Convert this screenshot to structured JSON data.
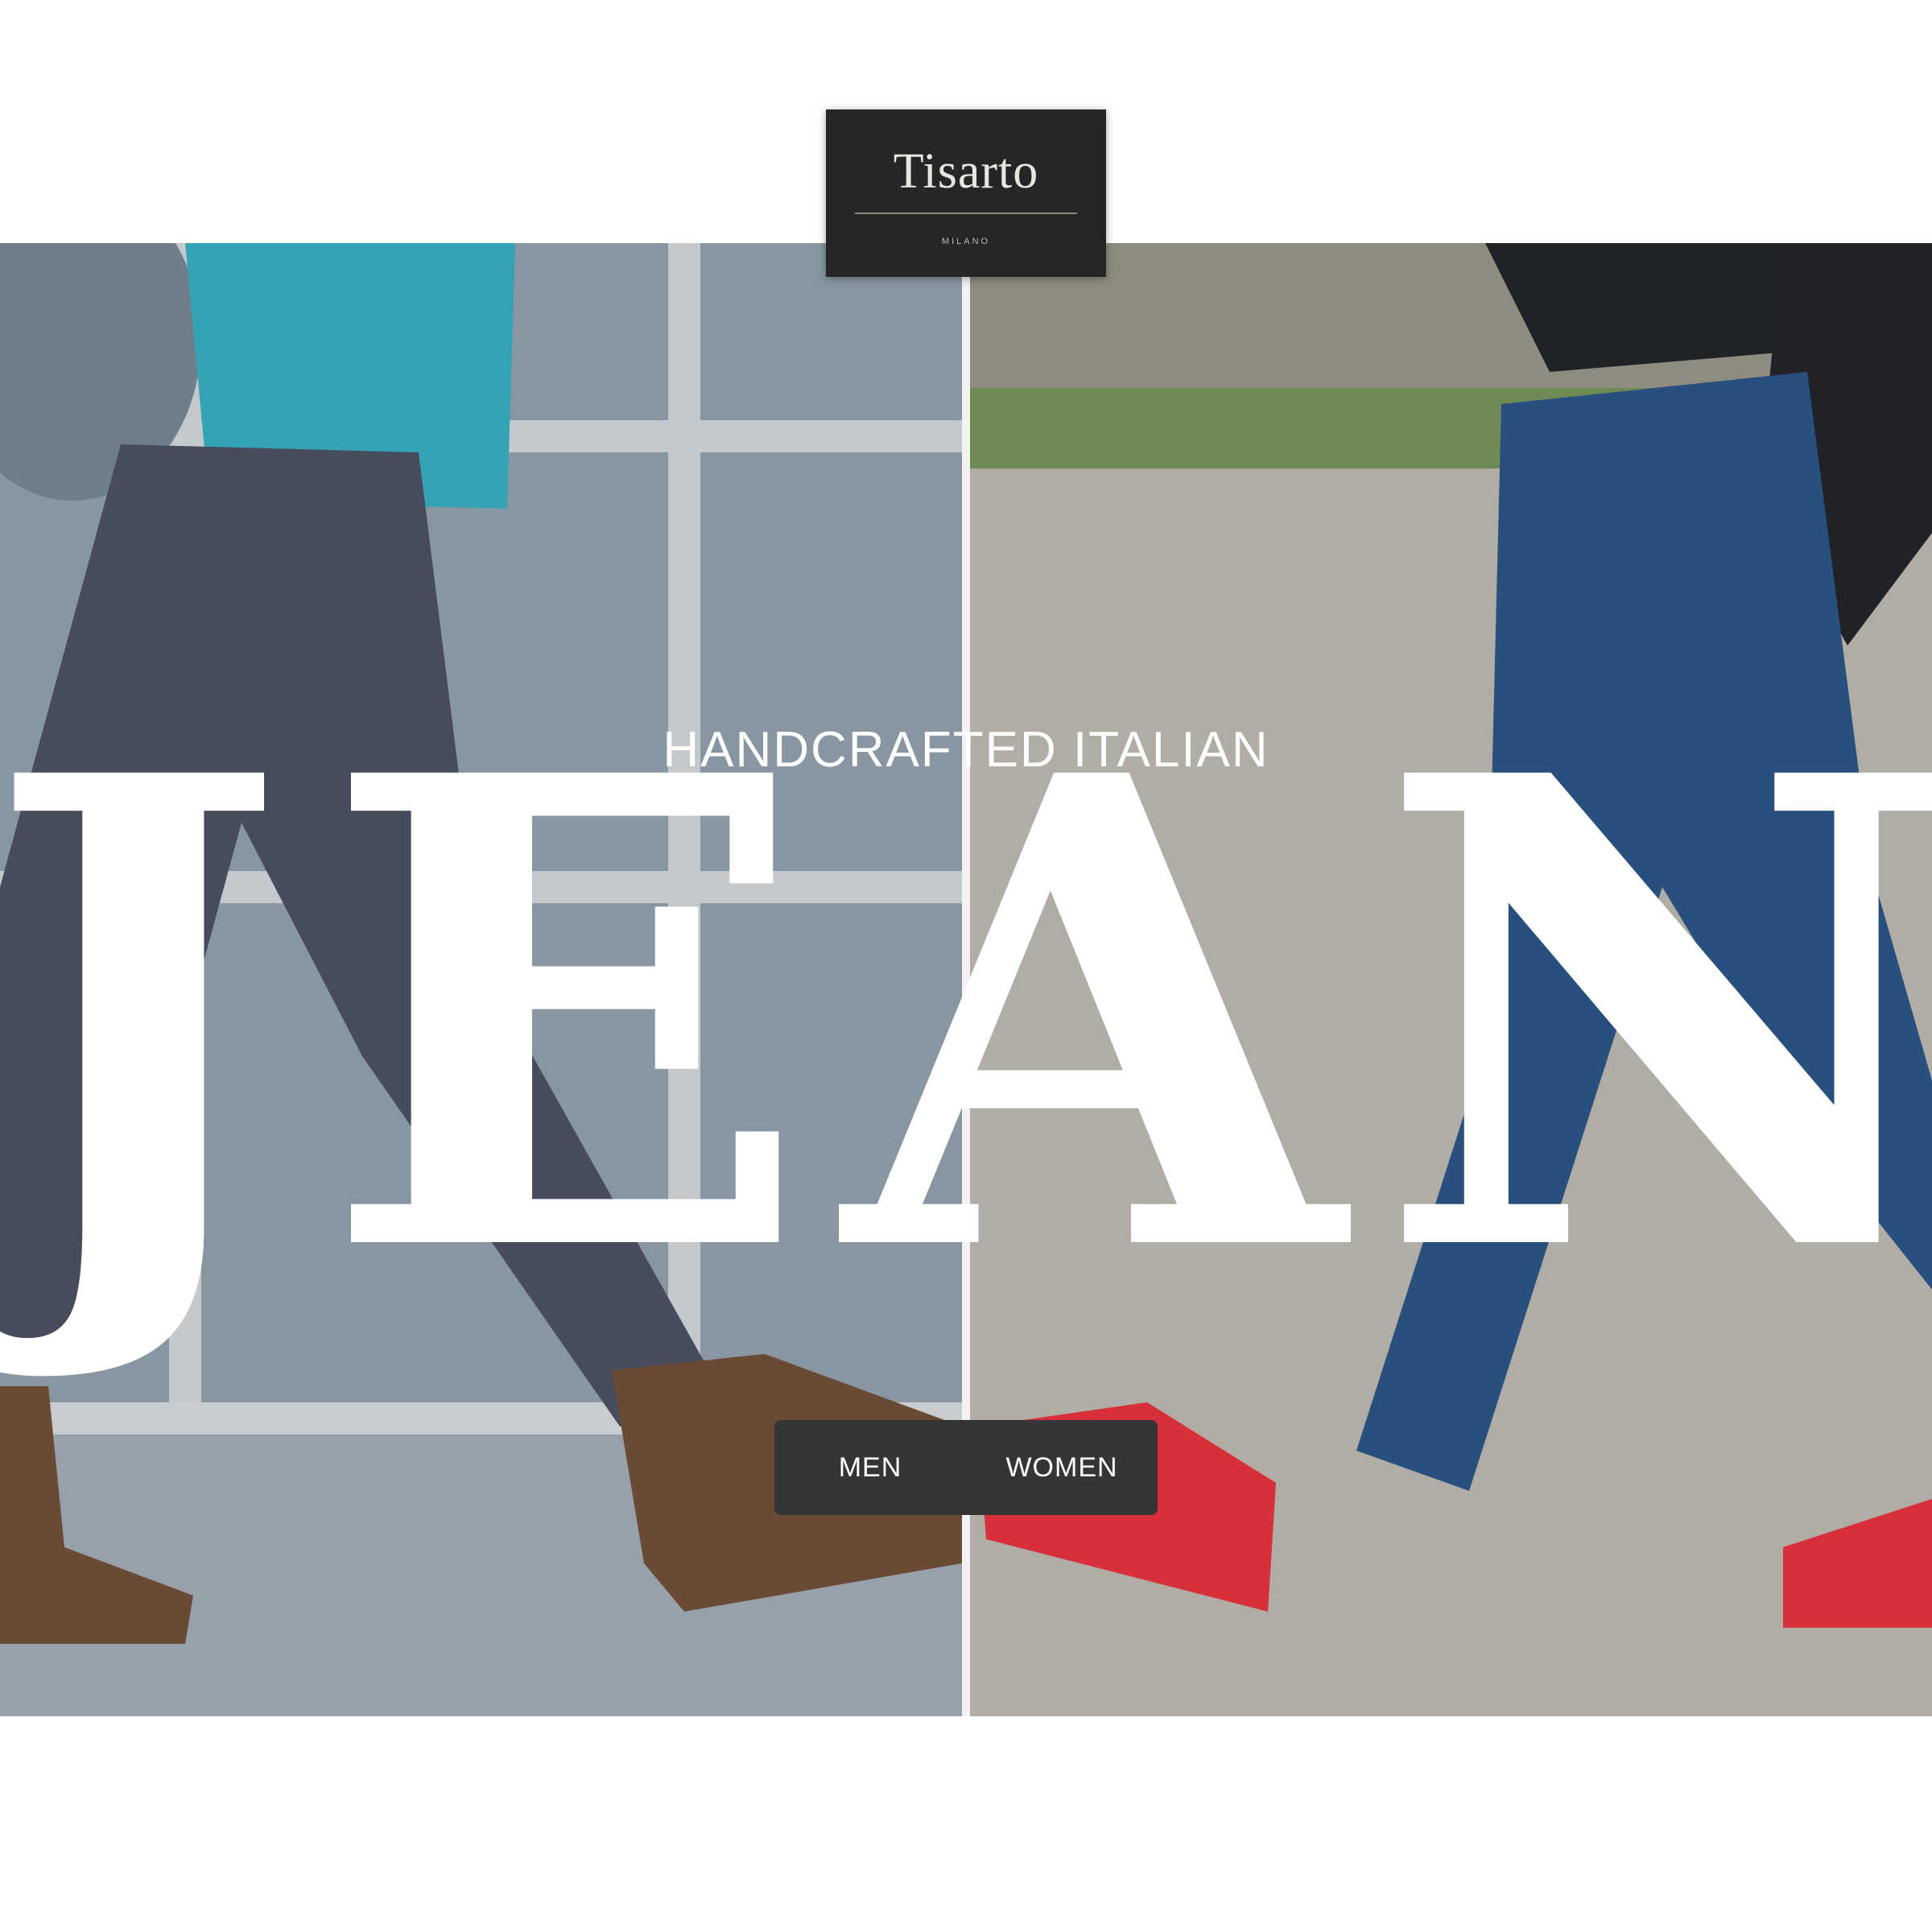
{
  "logo": {
    "wordmark": "Tisarto",
    "subtitle": "MILANO"
  },
  "hero": {
    "tagline": "HANDCRAFTED ITALIAN",
    "headline": "JEANS"
  },
  "gender_toggle": {
    "men_label": "MEN",
    "women_label": "WOMEN"
  },
  "colors": {
    "logo_background": "#262626",
    "button_background": "#353535",
    "text_on_image": "#ffffff"
  }
}
